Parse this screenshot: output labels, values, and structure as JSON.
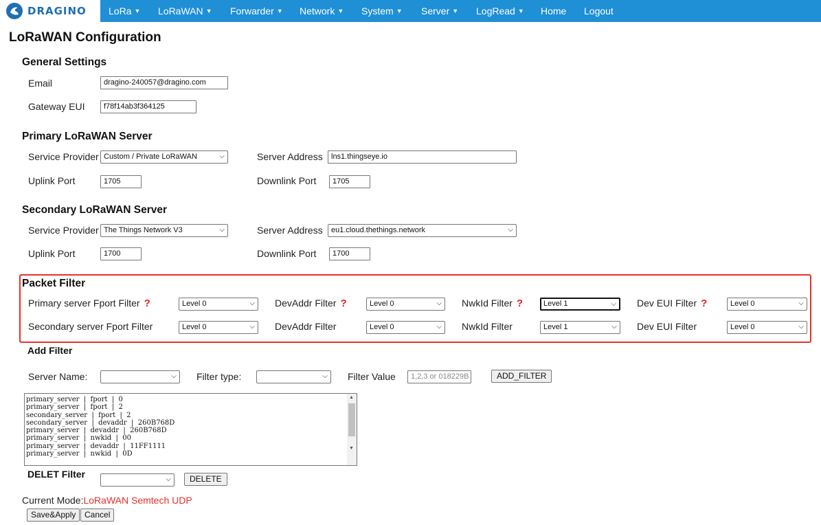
{
  "nav": {
    "brand": "DRAGINO",
    "items": [
      {
        "label": "LoRa",
        "caret": "▼"
      },
      {
        "label": "LoRaWAN",
        "caret": "▼"
      },
      {
        "label": "Forwarder",
        "caret": "▼"
      },
      {
        "label": "Network",
        "caret": "▼"
      },
      {
        "label": "System",
        "caret": "▼"
      },
      {
        "label": "Server",
        "caret": "▼"
      },
      {
        "label": "LogRead",
        "caret": "▼"
      },
      {
        "label": "Home",
        "caret": ""
      },
      {
        "label": "Logout",
        "caret": ""
      }
    ]
  },
  "page_title": "LoRaWAN Configuration",
  "general": {
    "heading": "General Settings",
    "email_label": "Email",
    "email_value": "dragino-240057@dragino.com",
    "eui_label": "Gateway EUI",
    "eui_value": "f78f14ab3f364125"
  },
  "primary": {
    "heading": "Primary LoRaWAN Server",
    "provider_label": "Service Provider",
    "provider_value": "Custom / Private LoRaWAN",
    "address_label": "Server Address",
    "address_value": "lns1.thingseye.io",
    "uplink_label": "Uplink Port",
    "uplink_value": "1705",
    "downlink_label": "Downlink Port",
    "downlink_value": "1705"
  },
  "secondary": {
    "heading": "Secondary LoRaWAN Server",
    "provider_label": "Service Provider",
    "provider_value": "The Things Network V3",
    "address_label": "Server Address",
    "address_value": "eu1.cloud.thethings.network",
    "uplink_label": "Uplink Port",
    "uplink_value": "1700",
    "downlink_label": "Downlink Port",
    "downlink_value": "1700"
  },
  "packet_filter": {
    "heading": "Packet Filter",
    "help": "?",
    "row1": {
      "fport_label": "Primary server Fport Filter",
      "fport_value": "Level 0",
      "devaddr_label": "DevAddr Filter",
      "devaddr_value": "Level 0",
      "nwkid_label": "NwkId Filter",
      "nwkid_value": "Level 1",
      "deveui_label": "Dev EUI Filter",
      "deveui_value": "Level 0"
    },
    "row2": {
      "fport_label": "Secondary server Fport Filter",
      "fport_value": "Level 0",
      "devaddr_label": "DevAddr Filter",
      "devaddr_value": "Level 0",
      "nwkid_label": "NwkId Filter",
      "nwkid_value": "Level 1",
      "deveui_label": "Dev EUI Filter",
      "deveui_value": "Level 0"
    }
  },
  "add_filter": {
    "heading": "Add Filter",
    "server_name_label": "Server Name:",
    "server_name_value": "",
    "filter_type_label": "Filter type:",
    "filter_type_value": "",
    "filter_value_label": "Filter Value",
    "filter_value_placeholder": "1,2,3 or 018229B",
    "add_button": "ADD_FILTER"
  },
  "filter_list": "primary_server  |  fport  |  0\nprimary_server  |  fport  |  2\nsecondary_server  |  fport  |  2\nsecondary_server  |  devaddr  |  260B768D\nprimary_server  |  devaddr  |  260B768D\nprimary_server  |  nwkid  |  00\nprimary_server  |  devaddr  |  11FF1111\nprimary_server  |  nwkid  |  0D",
  "delete_filter": {
    "heading": "DELET Filter",
    "select_value": "",
    "button": "DELETE"
  },
  "current_mode": {
    "label": "Current Mode:",
    "value": "LoRaWAN Semtech UDP"
  },
  "actions": {
    "save": "Save&Apply",
    "cancel": "Cancel"
  },
  "icons": {
    "dropdown": "chevron-down-icon",
    "logo": "dragino-logo-icon"
  },
  "colors": {
    "nav_bg": "#1f8fd6",
    "highlight_border": "#e8302a",
    "help_mark": "#e02020",
    "mode_value": "#e8302a"
  }
}
